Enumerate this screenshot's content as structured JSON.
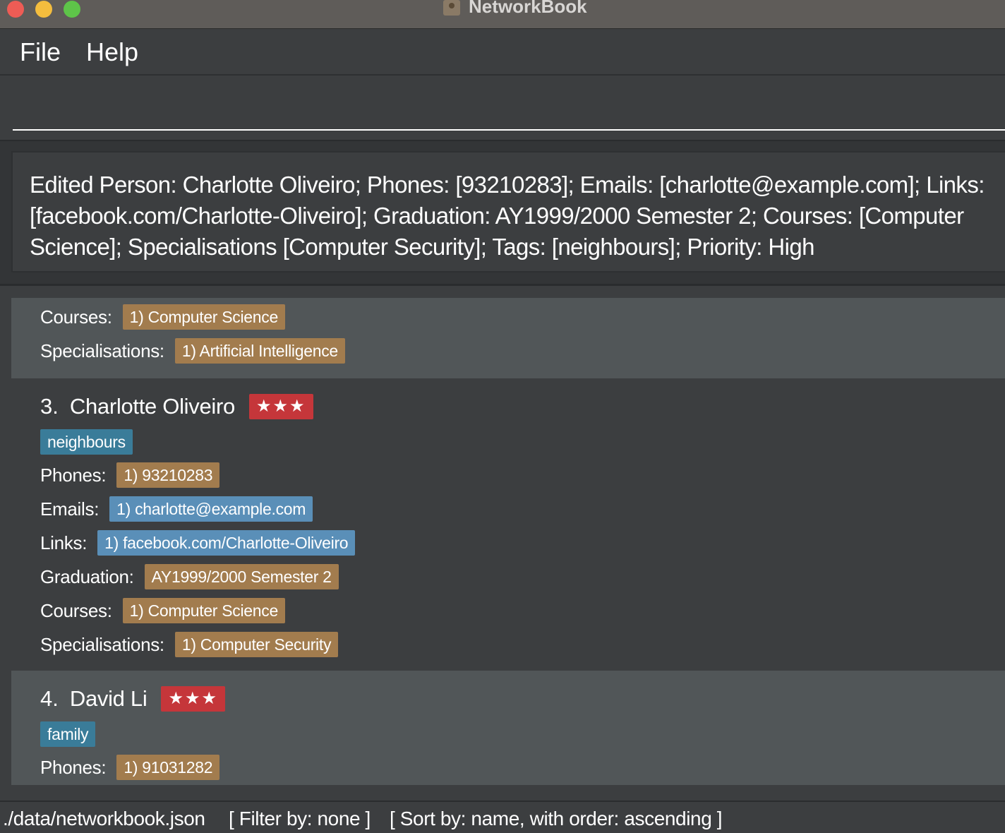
{
  "window": {
    "title": "NetworkBook"
  },
  "menu": {
    "file": "File",
    "help": "Help"
  },
  "command": {
    "value": "",
    "placeholder": ""
  },
  "result": {
    "lines": [
      "Edited Person: Charlotte Oliveiro; Phones: [93210283]; Emails: [charlotte@example.com]; Links:",
      "[facebook.com/Charlotte-Oliveiro]; Graduation: AY1999/2000 Semester 2; Courses: [Computer",
      "Science]; Specialisations [Computer Security]; Tags: [neighbours]; Priority: High"
    ]
  },
  "labels": {
    "phones": "Phones:",
    "emails": "Emails:",
    "links": "Links:",
    "graduation": "Graduation:",
    "courses": "Courses:",
    "specialisations": "Specialisations:"
  },
  "persons": [
    {
      "courses": "1) Computer Science",
      "specialisations": "1) Artificial Intelligence"
    },
    {
      "index": "3.",
      "name": "Charlotte Oliveiro",
      "priority": "★★★",
      "tag": "neighbours",
      "phones": "1) 93210283",
      "emails": "1) charlotte@example.com",
      "links": "1) facebook.com/Charlotte-Oliveiro",
      "graduation": "AY1999/2000 Semester 2",
      "courses": "1) Computer Science",
      "specialisations": "1) Computer Security"
    },
    {
      "index": "4.",
      "name": "David Li",
      "priority": "★★★",
      "tag": "family",
      "phones": "1) 91031282"
    }
  ],
  "status": {
    "path": "./data/networkbook.json",
    "filter": "[ Filter by: none ]",
    "sort": "[ Sort by: name, with order: ascending ]"
  },
  "colors": {
    "background": "#3c3e40",
    "card_alt": "#515658",
    "chip_tan": "#a27c4e",
    "chip_blue": "#5a8fb8",
    "chip_tag": "#3a7c99",
    "priority_red": "#c5363a"
  }
}
